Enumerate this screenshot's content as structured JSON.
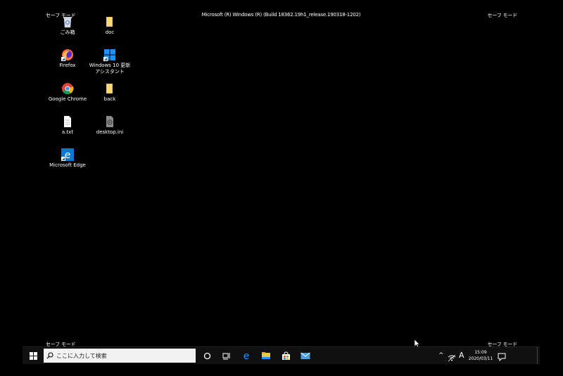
{
  "window": {
    "safe_mode": "セーフ モード",
    "build_info": "Microsoft (R) Windows (R) (Build 18362.19h1_release.190318-1202)"
  },
  "desktop": {
    "icons": [
      {
        "label": "ごみ箱"
      },
      {
        "label": "doc"
      },
      {
        "label": "Firefox"
      },
      {
        "label": "Windows 10 更新アシスタント"
      },
      {
        "label": "Google Chrome"
      },
      {
        "label": "back"
      },
      {
        "label": "a.txt"
      },
      {
        "label": "desktop.ini"
      },
      {
        "label": "Microsoft Edge"
      }
    ]
  },
  "taskbar": {
    "search_placeholder": "ここに入力して検索",
    "ime": "A",
    "time": "15:09",
    "date": "2020/03/11"
  },
  "colors": {
    "background": "#000000",
    "taskbar": "#101010",
    "accent_blue": "#1e90ff"
  }
}
